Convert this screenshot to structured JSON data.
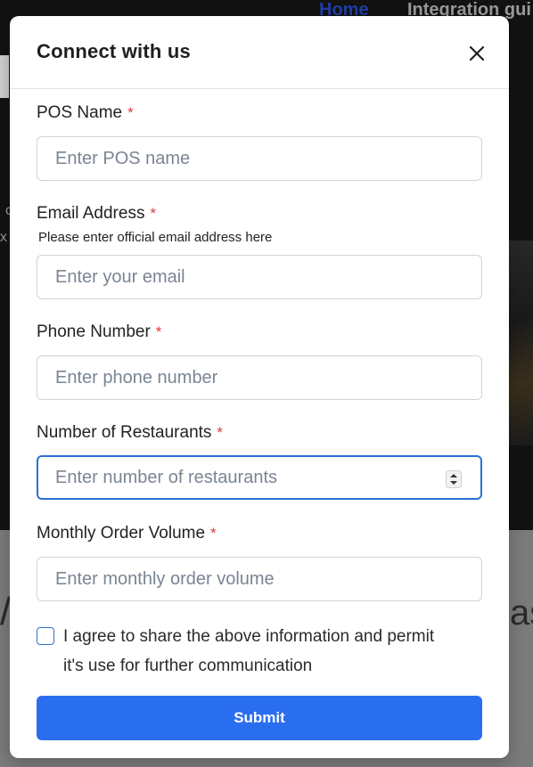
{
  "background": {
    "nav": {
      "home": "Home",
      "integration": "Integration gui"
    },
    "left_snippet_1": "c",
    "left_snippet_2": "x",
    "bottom_snippet_left": "/",
    "bottom_snippet_right": "as"
  },
  "modal": {
    "title": "Connect with us",
    "close_icon": "close-icon",
    "fields": {
      "pos_name": {
        "label": "POS Name",
        "required_mark": "*",
        "placeholder": "Enter POS name",
        "value": ""
      },
      "email": {
        "label": "Email Address",
        "required_mark": "*",
        "helper": "Please enter official email address here",
        "placeholder": "Enter your email",
        "value": ""
      },
      "phone": {
        "label": "Phone Number",
        "required_mark": "*",
        "placeholder": "Enter phone number",
        "value": ""
      },
      "restaurants": {
        "label": "Number of Restaurants",
        "required_mark": "*",
        "placeholder": "Enter number of restaurants",
        "value": "",
        "focused": true
      },
      "monthly_volume": {
        "label": "Monthly Order Volume",
        "required_mark": "*",
        "placeholder": "Enter monthly order volume",
        "value": ""
      }
    },
    "agree": {
      "checked": false,
      "text": "I agree to share the above information and permit it's use for further communication"
    },
    "submit_label": "Submit"
  },
  "colors": {
    "accent": "#2a6ef0",
    "focus_border": "#2a6fd6",
    "required": "#e03a3a",
    "backdrop_dark": "#121212",
    "backdrop_light": "#7b7b7b"
  }
}
